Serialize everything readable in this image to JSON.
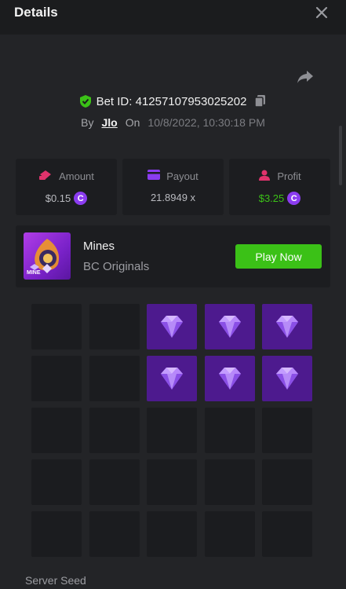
{
  "header": {
    "title": "Details",
    "close_icon": "close-icon"
  },
  "bet": {
    "id_label": "Bet ID: 41257107953025202",
    "by_label": "By",
    "username": "Jlo",
    "on_label": "On",
    "datetime": "10/8/2022, 10:30:18 PM"
  },
  "stats": {
    "amount_label": "Amount",
    "amount_value": "$0.15",
    "payout_label": "Payout",
    "payout_value": "21.8949 x",
    "profit_label": "Profit",
    "profit_value": "$3.25",
    "profit_color": "#3bc117"
  },
  "game": {
    "name": "Mines",
    "provider": "BC Originals",
    "play_label": "Play Now",
    "thumb_text": "MINE",
    "button_color": "#3bc117"
  },
  "board": {
    "rows": 5,
    "cols": 5,
    "revealed_gems": [
      [
        0,
        2
      ],
      [
        0,
        3
      ],
      [
        0,
        4
      ],
      [
        1,
        2
      ],
      [
        1,
        3
      ],
      [
        1,
        4
      ]
    ],
    "gem_color": "#4d1a8e"
  },
  "seed": {
    "server_seed_label": "Server Seed"
  }
}
